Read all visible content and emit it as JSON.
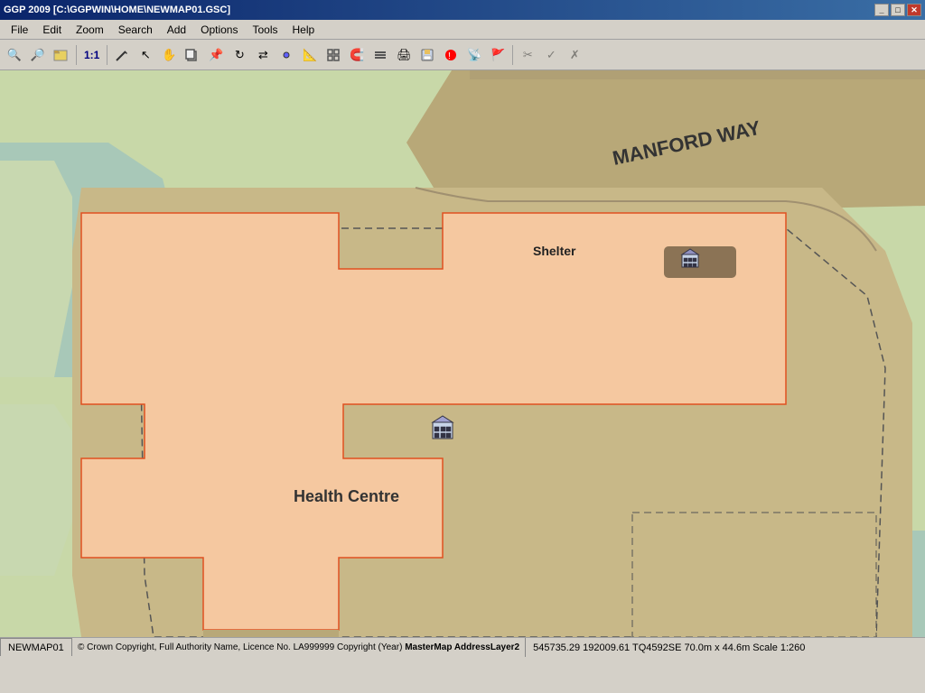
{
  "titlebar": {
    "title": "GGP 2009 [C:\\GGPWIN\\HOME\\NEWMAP01.GSC]",
    "minimize_label": "_",
    "maximize_label": "□",
    "close_label": "✕"
  },
  "menubar": {
    "items": [
      {
        "label": "File",
        "id": "file"
      },
      {
        "label": "Edit",
        "id": "edit"
      },
      {
        "label": "Zoom",
        "id": "zoom"
      },
      {
        "label": "Search",
        "id": "search"
      },
      {
        "label": "Add",
        "id": "add"
      },
      {
        "label": "Options",
        "id": "options"
      },
      {
        "label": "Tools",
        "id": "tools"
      },
      {
        "label": "Help",
        "id": "help"
      }
    ]
  },
  "toolbar": {
    "scale_label": "1:1",
    "icons": [
      {
        "name": "zoom-in",
        "glyph": "🔍"
      },
      {
        "name": "zoom-out",
        "glyph": "🔎"
      },
      {
        "name": "open",
        "glyph": "📂"
      },
      {
        "name": "scale",
        "glyph": ""
      },
      {
        "name": "pencil",
        "glyph": "✏️"
      },
      {
        "name": "select",
        "glyph": "↖"
      },
      {
        "name": "hand",
        "glyph": "✋"
      },
      {
        "name": "copy",
        "glyph": "📋"
      },
      {
        "name": "paste",
        "glyph": "📌"
      },
      {
        "name": "rotate",
        "glyph": "↻"
      },
      {
        "name": "mirror",
        "glyph": "⇄"
      },
      {
        "name": "node",
        "glyph": "⬥"
      },
      {
        "name": "measure",
        "glyph": "📐"
      },
      {
        "name": "grid",
        "glyph": "⊞"
      },
      {
        "name": "snap",
        "glyph": "🧲"
      },
      {
        "name": "layers",
        "glyph": "≡"
      },
      {
        "name": "print",
        "glyph": "🖨"
      },
      {
        "name": "save",
        "glyph": "💾"
      },
      {
        "name": "stop",
        "glyph": "⛔"
      },
      {
        "name": "gps",
        "glyph": "📡"
      },
      {
        "name": "flag",
        "glyph": "🚩"
      },
      {
        "name": "cut",
        "glyph": "✂"
      },
      {
        "name": "checkmark",
        "glyph": "✓"
      },
      {
        "name": "cross",
        "glyph": "✗"
      }
    ]
  },
  "map": {
    "road_label": "MANFORD WAY",
    "shelter_label": "Shelter",
    "health_centre_label": "Health Centre",
    "colors": {
      "road": "#b8a878",
      "grass": "#c8d8a8",
      "building_outline": "#f0a878",
      "building_fill": "#f5c8a0",
      "dashed_area": "#c8b888",
      "teal_area": "#a8c8b8"
    }
  },
  "statusbar": {
    "tab_label": "NEWMAP01",
    "coords": "545735.29  192009.61  TQ4592SE  70.0m x 44.6m  Scale 1:260",
    "copyright": "© Crown Copyright, Full Authority Name, Licence No. LA999999 Copyright (Year)",
    "layer": "MasterMap AddressLayer2"
  }
}
